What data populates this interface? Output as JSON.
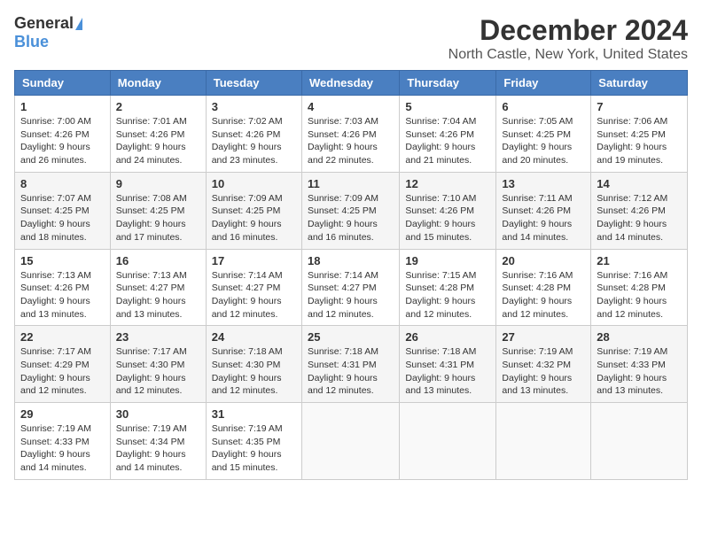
{
  "header": {
    "logo_general": "General",
    "logo_blue": "Blue",
    "title": "December 2024",
    "location": "North Castle, New York, United States"
  },
  "weekdays": [
    "Sunday",
    "Monday",
    "Tuesday",
    "Wednesday",
    "Thursday",
    "Friday",
    "Saturday"
  ],
  "weeks": [
    [
      {
        "day": "1",
        "sunrise": "7:00 AM",
        "sunset": "4:26 PM",
        "daylight": "9 hours and 26 minutes."
      },
      {
        "day": "2",
        "sunrise": "7:01 AM",
        "sunset": "4:26 PM",
        "daylight": "9 hours and 24 minutes."
      },
      {
        "day": "3",
        "sunrise": "7:02 AM",
        "sunset": "4:26 PM",
        "daylight": "9 hours and 23 minutes."
      },
      {
        "day": "4",
        "sunrise": "7:03 AM",
        "sunset": "4:26 PM",
        "daylight": "9 hours and 22 minutes."
      },
      {
        "day": "5",
        "sunrise": "7:04 AM",
        "sunset": "4:26 PM",
        "daylight": "9 hours and 21 minutes."
      },
      {
        "day": "6",
        "sunrise": "7:05 AM",
        "sunset": "4:25 PM",
        "daylight": "9 hours and 20 minutes."
      },
      {
        "day": "7",
        "sunrise": "7:06 AM",
        "sunset": "4:25 PM",
        "daylight": "9 hours and 19 minutes."
      }
    ],
    [
      {
        "day": "8",
        "sunrise": "7:07 AM",
        "sunset": "4:25 PM",
        "daylight": "9 hours and 18 minutes."
      },
      {
        "day": "9",
        "sunrise": "7:08 AM",
        "sunset": "4:25 PM",
        "daylight": "9 hours and 17 minutes."
      },
      {
        "day": "10",
        "sunrise": "7:09 AM",
        "sunset": "4:25 PM",
        "daylight": "9 hours and 16 minutes."
      },
      {
        "day": "11",
        "sunrise": "7:09 AM",
        "sunset": "4:25 PM",
        "daylight": "9 hours and 16 minutes."
      },
      {
        "day": "12",
        "sunrise": "7:10 AM",
        "sunset": "4:26 PM",
        "daylight": "9 hours and 15 minutes."
      },
      {
        "day": "13",
        "sunrise": "7:11 AM",
        "sunset": "4:26 PM",
        "daylight": "9 hours and 14 minutes."
      },
      {
        "day": "14",
        "sunrise": "7:12 AM",
        "sunset": "4:26 PM",
        "daylight": "9 hours and 14 minutes."
      }
    ],
    [
      {
        "day": "15",
        "sunrise": "7:13 AM",
        "sunset": "4:26 PM",
        "daylight": "9 hours and 13 minutes."
      },
      {
        "day": "16",
        "sunrise": "7:13 AM",
        "sunset": "4:27 PM",
        "daylight": "9 hours and 13 minutes."
      },
      {
        "day": "17",
        "sunrise": "7:14 AM",
        "sunset": "4:27 PM",
        "daylight": "9 hours and 12 minutes."
      },
      {
        "day": "18",
        "sunrise": "7:14 AM",
        "sunset": "4:27 PM",
        "daylight": "9 hours and 12 minutes."
      },
      {
        "day": "19",
        "sunrise": "7:15 AM",
        "sunset": "4:28 PM",
        "daylight": "9 hours and 12 minutes."
      },
      {
        "day": "20",
        "sunrise": "7:16 AM",
        "sunset": "4:28 PM",
        "daylight": "9 hours and 12 minutes."
      },
      {
        "day": "21",
        "sunrise": "7:16 AM",
        "sunset": "4:28 PM",
        "daylight": "9 hours and 12 minutes."
      }
    ],
    [
      {
        "day": "22",
        "sunrise": "7:17 AM",
        "sunset": "4:29 PM",
        "daylight": "9 hours and 12 minutes."
      },
      {
        "day": "23",
        "sunrise": "7:17 AM",
        "sunset": "4:30 PM",
        "daylight": "9 hours and 12 minutes."
      },
      {
        "day": "24",
        "sunrise": "7:18 AM",
        "sunset": "4:30 PM",
        "daylight": "9 hours and 12 minutes."
      },
      {
        "day": "25",
        "sunrise": "7:18 AM",
        "sunset": "4:31 PM",
        "daylight": "9 hours and 12 minutes."
      },
      {
        "day": "26",
        "sunrise": "7:18 AM",
        "sunset": "4:31 PM",
        "daylight": "9 hours and 13 minutes."
      },
      {
        "day": "27",
        "sunrise": "7:19 AM",
        "sunset": "4:32 PM",
        "daylight": "9 hours and 13 minutes."
      },
      {
        "day": "28",
        "sunrise": "7:19 AM",
        "sunset": "4:33 PM",
        "daylight": "9 hours and 13 minutes."
      }
    ],
    [
      {
        "day": "29",
        "sunrise": "7:19 AM",
        "sunset": "4:33 PM",
        "daylight": "9 hours and 14 minutes."
      },
      {
        "day": "30",
        "sunrise": "7:19 AM",
        "sunset": "4:34 PM",
        "daylight": "9 hours and 14 minutes."
      },
      {
        "day": "31",
        "sunrise": "7:19 AM",
        "sunset": "4:35 PM",
        "daylight": "9 hours and 15 minutes."
      },
      null,
      null,
      null,
      null
    ]
  ]
}
